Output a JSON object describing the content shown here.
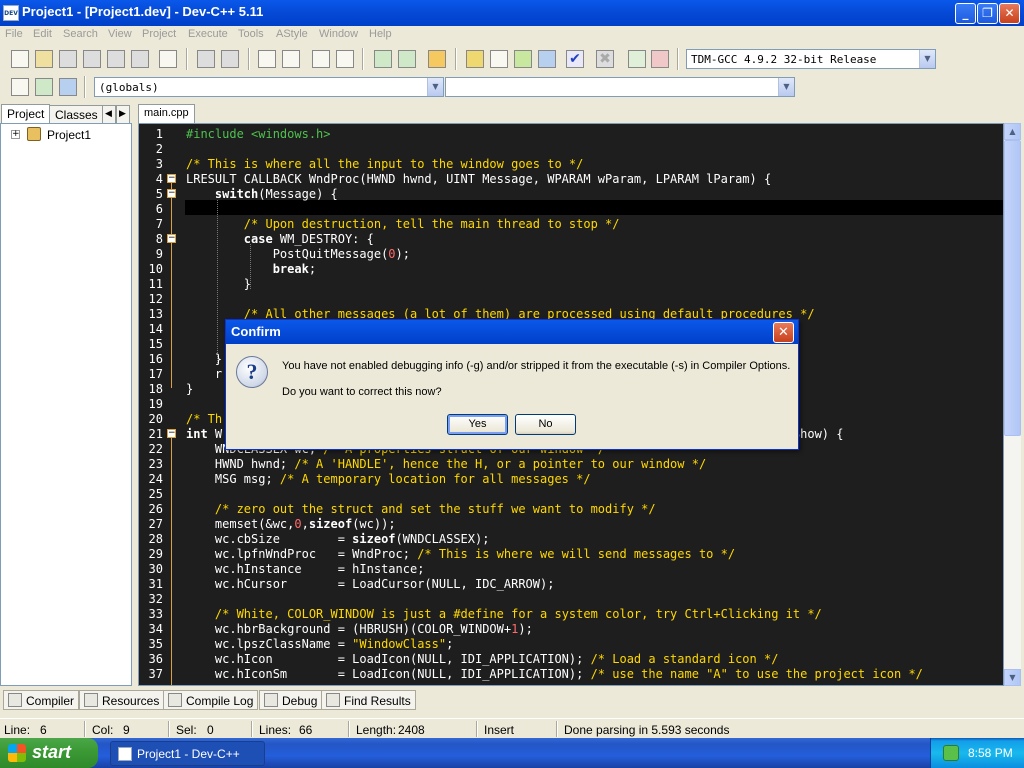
{
  "window": {
    "title": "Project1 - [Project1.dev] - Dev-C++ 5.11",
    "min": "_",
    "max": "❐",
    "close": "✕"
  },
  "menu": [
    "File",
    "Edit",
    "Search",
    "View",
    "Project",
    "Execute",
    "Tools",
    "AStyle",
    "Window",
    "Help"
  ],
  "toolbar": {
    "compiler_select": "TDM-GCC 4.9.2 32-bit Release",
    "scope_select": "(globals)",
    "member_select": ""
  },
  "left_panel": {
    "tabs": [
      "Project",
      "Classes"
    ],
    "tree_root": "Project1"
  },
  "editor": {
    "tab": "main.cpp",
    "lines": [
      {
        "n": "1",
        "html": "<span class='c-pp'>#include &lt;windows.h&gt;</span>"
      },
      {
        "n": "2",
        "html": ""
      },
      {
        "n": "3",
        "html": "<span class='c-cm'>/* This is where all the input to the window goes to */</span>"
      },
      {
        "n": "4",
        "html": "LRESULT CALLBACK WndProc(HWND hwnd, UINT Message, WPARAM wParam, LPARAM lParam) {"
      },
      {
        "n": "5",
        "html": "    <span class='c-kw'>switch</span>(Message) {"
      },
      {
        "n": "6",
        "html": ""
      },
      {
        "n": "7",
        "html": "        <span class='c-cm'>/* Upon destruction, tell the main thread to stop */</span>"
      },
      {
        "n": "8",
        "html": "        <span class='c-kw'>case</span> WM_DESTROY: {"
      },
      {
        "n": "9",
        "html": "            PostQuitMessage(<span class='c-num'>0</span>);"
      },
      {
        "n": "10",
        "html": "            <span class='c-kw'>break</span>;"
      },
      {
        "n": "11",
        "html": "        }"
      },
      {
        "n": "12",
        "html": ""
      },
      {
        "n": "13",
        "html": "        <span class='c-cm'>/* All other messages (a lot of them) are processed using default procedures */</span>"
      },
      {
        "n": "14",
        "html": ""
      },
      {
        "n": "15",
        "html": ""
      },
      {
        "n": "16",
        "html": "    }"
      },
      {
        "n": "17",
        "html": "    r"
      },
      {
        "n": "18",
        "html": "}"
      },
      {
        "n": "19",
        "html": ""
      },
      {
        "n": "20",
        "html": "<span class='c-cm'>/* Th                                                                         */</span>"
      },
      {
        "n": "21",
        "html": "<span class='c-kw'>int</span> W                                                                  ine, <span class='c-kw'>int</span> nCmdShow) {"
      },
      {
        "n": "22",
        "html": "    WNDCLASSEX wc; <span class='c-cm'>/* A properties struct of our window */</span>"
      },
      {
        "n": "23",
        "html": "    HWND hwnd; <span class='c-cm'>/* A 'HANDLE', hence the H, or a pointer to our window */</span>"
      },
      {
        "n": "24",
        "html": "    MSG msg; <span class='c-cm'>/* A temporary location for all messages */</span>"
      },
      {
        "n": "25",
        "html": ""
      },
      {
        "n": "26",
        "html": "    <span class='c-cm'>/* zero out the struct and set the stuff we want to modify */</span>"
      },
      {
        "n": "27",
        "html": "    memset(&amp;wc,<span class='c-num'>0</span>,<span class='c-kw'>sizeof</span>(wc));"
      },
      {
        "n": "28",
        "html": "    wc.cbSize        = <span class='c-kw'>sizeof</span>(WNDCLASSEX);"
      },
      {
        "n": "29",
        "html": "    wc.lpfnWndProc   = WndProc; <span class='c-cm'>/* This is where we will send messages to */</span>"
      },
      {
        "n": "30",
        "html": "    wc.hInstance     = hInstance;"
      },
      {
        "n": "31",
        "html": "    wc.hCursor       = LoadCursor(NULL, IDC_ARROW);"
      },
      {
        "n": "32",
        "html": ""
      },
      {
        "n": "33",
        "html": "    <span class='c-cm'>/* White, COLOR_WINDOW is just a #define for a system color, try Ctrl+Clicking it */</span>"
      },
      {
        "n": "34",
        "html": "    wc.hbrBackground = (HBRUSH)(COLOR_WINDOW+<span class='c-num'>1</span>);"
      },
      {
        "n": "35",
        "html": "    wc.lpszClassName = <span class='c-str'>\"WindowClass\"</span>;"
      },
      {
        "n": "36",
        "html": "    wc.hIcon         = LoadIcon(NULL, IDI_APPLICATION); <span class='c-cm'>/* Load a standard icon */</span>"
      },
      {
        "n": "37",
        "html": "    wc.hIconSm       = LoadIcon(NULL, IDI_APPLICATION); <span class='c-cm'>/* use the name \"A\" to use the project icon */</span>"
      }
    ]
  },
  "bottom_tabs": [
    "Compiler",
    "Resources",
    "Compile Log",
    "Debug",
    "Find Results"
  ],
  "status": {
    "line_label": "Line:",
    "line": "6",
    "col_label": "Col:",
    "col": "9",
    "sel_label": "Sel:",
    "sel": "0",
    "lines_label": "Lines:",
    "lines": "66",
    "length_label": "Length:",
    "length": "2408",
    "mode": "Insert",
    "message": "Done parsing in 5.593 seconds"
  },
  "dialog": {
    "title": "Confirm",
    "message1": "You have not enabled debugging info (-g) and/or stripped it from the executable (-s) in Compiler Options.",
    "message2": "Do you want to correct this now?",
    "yes": "Yes",
    "no": "No"
  },
  "taskbar": {
    "start": "start",
    "task_item": "Project1 - Dev-C++",
    "clock": "8:58 PM"
  }
}
